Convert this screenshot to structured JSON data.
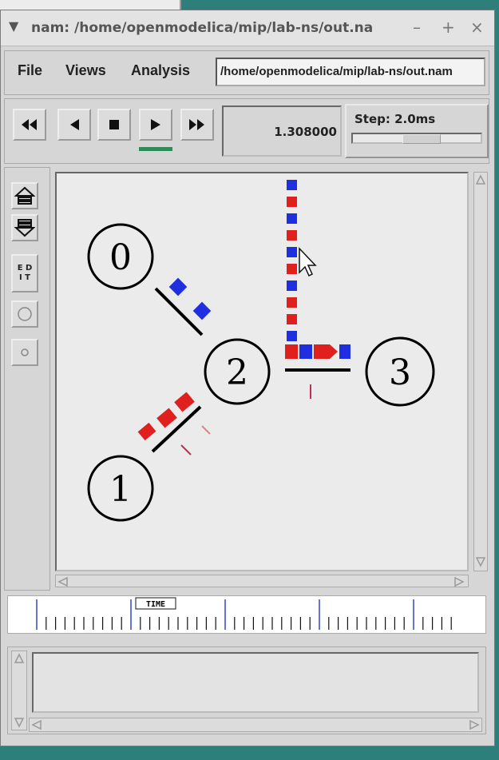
{
  "window": {
    "title": "nam: /home/openmodelica/mip/lab-ns/out.na",
    "controls": {
      "minimize": "–",
      "maximize": "+",
      "close": "×"
    }
  },
  "menubar": {
    "file": "File",
    "views": "Views",
    "analysis": "Analysis",
    "file_path": "/home/openmodelica/mip/lab-ns/out.nam"
  },
  "playback": {
    "time": "1.308000",
    "step_label": "Step: 2.0ms",
    "step_slider_level": 0.47,
    "state": "playing"
  },
  "tools": {
    "edit_label_1": "E D",
    "edit_label_2": "I T"
  },
  "nodes": [
    {
      "id": "0",
      "label": "0"
    },
    {
      "id": "1",
      "label": "1"
    },
    {
      "id": "2",
      "label": "2"
    },
    {
      "id": "3",
      "label": "3"
    }
  ],
  "timeline": {
    "marker_label": "TIME"
  },
  "colors": {
    "desktop": "#2c7f7a",
    "packet_blue": "#1f2fe0",
    "packet_red": "#e01f1f",
    "link": "#000000",
    "play_indicator": "#2e8b57"
  }
}
